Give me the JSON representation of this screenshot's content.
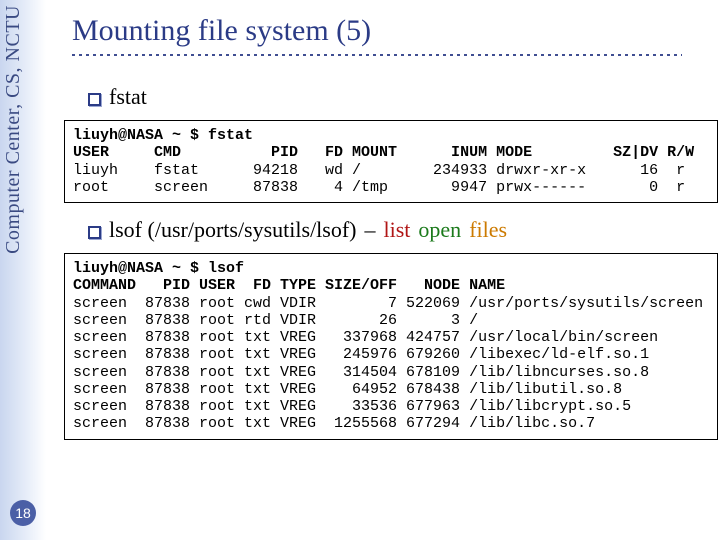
{
  "sidebar": {
    "text": "Computer Center, CS, NCTU",
    "page_number": "18"
  },
  "title": "Mounting file system (5)",
  "bullets": {
    "fstat": "fstat",
    "lsof_prefix": "lsof (/usr/ports/sysutils/lsof)",
    "dash": "–",
    "list": "list",
    "open": "open",
    "files": "files"
  },
  "fstat_output": {
    "prompt": "liuyh@NASA ~ $ fstat",
    "header": "USER     CMD          PID   FD MOUNT      INUM MODE         SZ|DV R/W",
    "rows": [
      "liuyh    fstat      94218   wd /        234933 drwxr-xr-x      16  r",
      "root     screen     87838    4 /tmp       9947 prwx------       0  r"
    ]
  },
  "lsof_output": {
    "prompt": "liuyh@NASA ~ $ lsof",
    "header": "COMMAND   PID USER  FD TYPE SIZE/OFF   NODE NAME",
    "rows": [
      "screen  87838 root cwd VDIR        7 522069 /usr/ports/sysutils/screen",
      "screen  87838 root rtd VDIR       26      3 /",
      "screen  87838 root txt VREG   337968 424757 /usr/local/bin/screen",
      "screen  87838 root txt VREG   245976 679260 /libexec/ld-elf.so.1",
      "screen  87838 root txt VREG   314504 678109 /lib/libncurses.so.8",
      "screen  87838 root txt VREG    64952 678438 /lib/libutil.so.8",
      "screen  87838 root txt VREG    33536 677963 /lib/libcrypt.so.5",
      "screen  87838 root txt VREG  1255568 677294 /lib/libc.so.7"
    ]
  }
}
